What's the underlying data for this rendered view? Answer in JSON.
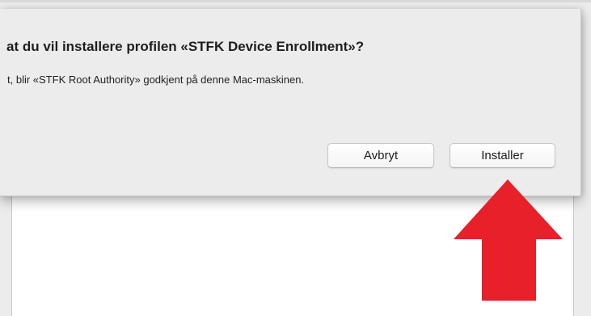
{
  "dialog": {
    "title": "at du vil installere profilen «STFK Device Enrollment»?",
    "message": "t, blir «STFK Root Authority» godkjent på denne Mac-maskinen.",
    "buttons": {
      "cancel_label": "Avbryt",
      "install_label": "Installer"
    }
  },
  "annotation": {
    "arrow_icon": "arrow-up-icon",
    "arrow_color": "#e8202a"
  }
}
